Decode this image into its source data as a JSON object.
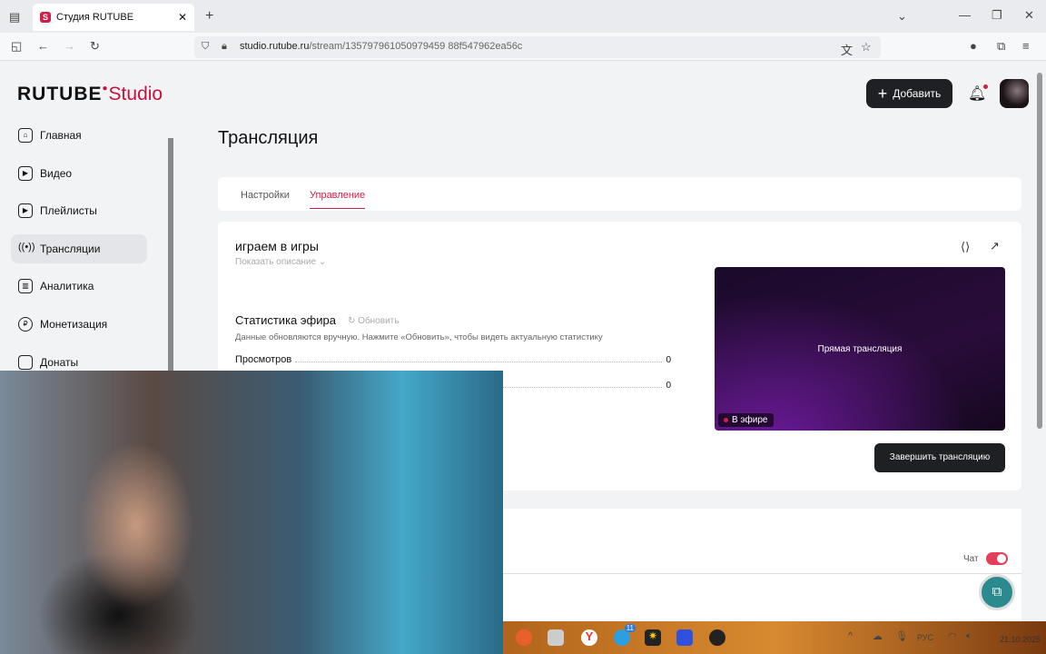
{
  "browser": {
    "tab_title": "Студия RUTUBE",
    "url_host": "studio.rutube.ru",
    "url_path": "/stream/135797961050979459 88f547962ea56c"
  },
  "header": {
    "logo_brand": "RUTUBE",
    "logo_product": "Studio",
    "add_label": "Добавить"
  },
  "sidebar": {
    "items": [
      {
        "label": "Главная",
        "icon": "home-icon"
      },
      {
        "label": "Видео",
        "icon": "video-icon"
      },
      {
        "label": "Плейлисты",
        "icon": "playlist-icon"
      },
      {
        "label": "Трансляции",
        "icon": "broadcast-icon",
        "active": true
      },
      {
        "label": "Аналитика",
        "icon": "analytics-icon"
      },
      {
        "label": "Монетизация",
        "icon": "ruble-icon"
      },
      {
        "label": "Донаты",
        "icon": "wallet-icon"
      }
    ]
  },
  "page": {
    "title": "Трансляция",
    "tabs": [
      {
        "label": "Настройки"
      },
      {
        "label": "Управление",
        "active": true
      }
    ]
  },
  "stream": {
    "title": "играем в игры",
    "show_description": "Показать описание",
    "stats_title": "Статистика эфира",
    "refresh_label": "Обновить",
    "stats_note": "Данные обновляются вручную. Нажмите «Обновить», чтобы видеть актуальную статистику",
    "stats": [
      {
        "label": "Просмотров",
        "value": "0"
      },
      {
        "label": "",
        "value": "0"
      }
    ],
    "player_label": "Прямая трансляция",
    "live_badge": "В эфире",
    "end_button": "Завершить трансляцию",
    "chat_label": "Чат",
    "chat_enabled": true
  },
  "taskbar": {
    "date": "21.10.2025",
    "lang": "РУС",
    "telegram_badge": "11"
  },
  "colors": {
    "accent": "#d11f47",
    "dark_button": "#1f2023",
    "help": "#2a8a8e"
  }
}
